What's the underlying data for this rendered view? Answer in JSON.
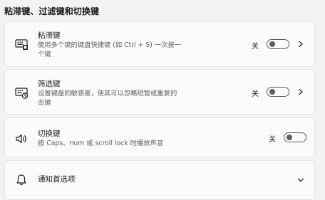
{
  "section_title": "粘滞键、过滤键和切换键",
  "cards": [
    {
      "title": "粘滞键",
      "desc_line1": "使用多个键的键盘快捷键 (如 Ctrl + S) 一次按一",
      "desc_line2": "个键",
      "state": "关",
      "icon": "sticky-keys-icon"
    },
    {
      "title": "筛选键",
      "desc_line1": "设置键盘的敏感度，使其可以忽略短暂或重复的",
      "desc_line2": "击键",
      "state": "关",
      "icon": "filter-keys-icon"
    },
    {
      "title": "切换键",
      "desc_line1": "按 Caps、num 或 scroll lock 时播放声音",
      "state": "关",
      "icon": "toggle-keys-sound-icon"
    },
    {
      "title": "通知首选项",
      "icon": "bell-icon"
    }
  ],
  "colors": {
    "background": "#f3f3f3",
    "card": "#fbfbfb",
    "border": "#e5e5e5",
    "toggle_off": "#5e5e5e"
  }
}
